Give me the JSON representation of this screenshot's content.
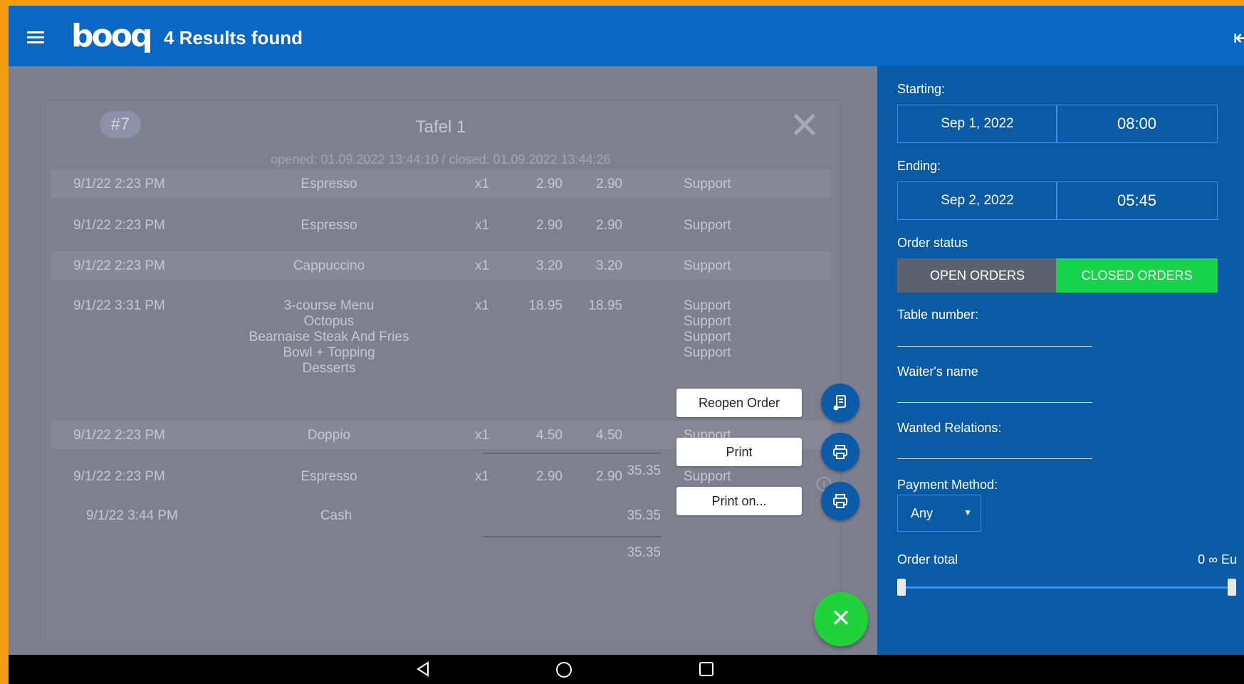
{
  "header": {
    "logo": "booq",
    "title": "4 Results found",
    "back_icon": "logout-arrow-icon"
  },
  "order": {
    "number": "#7",
    "table": "Tafel 1",
    "times": "opened: 01.09.2022 13:44:10 / closed: 01.09.2022 13:44:26",
    "rows": [
      {
        "time": "9/1/22 2:23 PM",
        "items": [
          "Espresso"
        ],
        "qty": "x1",
        "price": "2.90",
        "total": "2.90",
        "users": [
          "Support"
        ]
      },
      {
        "time": "9/1/22 2:23 PM",
        "items": [
          "Espresso"
        ],
        "qty": "x1",
        "price": "2.90",
        "total": "2.90",
        "users": [
          "Support"
        ]
      },
      {
        "time": "9/1/22 2:23 PM",
        "items": [
          "Cappuccino"
        ],
        "qty": "x1",
        "price": "3.20",
        "total": "3.20",
        "users": [
          "Support"
        ]
      },
      {
        "time": "9/1/22 3:31 PM",
        "items": [
          "3-course Menu",
          "Octopus",
          "Bearnaise Steak And Fries",
          "Bowl + Topping",
          "Desserts"
        ],
        "qty": "x1",
        "price": "18.95",
        "total": "18.95",
        "users": [
          "Support",
          "Support",
          "Support",
          "Support"
        ]
      },
      {
        "time": "9/1/22 2:23 PM",
        "items": [
          "Doppio"
        ],
        "qty": "x1",
        "price": "4.50",
        "total": "4.50",
        "users": [
          "Support"
        ]
      },
      {
        "time": "9/1/22 2:23 PM",
        "items": [
          "Espresso"
        ],
        "qty": "x1",
        "price": "2.90",
        "total": "2.90",
        "users": [
          "Support"
        ]
      }
    ],
    "subtotal": "35.35",
    "payment": {
      "time": "9/1/22 3:44 PM",
      "method": "Cash",
      "amount": "35.35"
    },
    "grand_total": "35.35",
    "info_icon": "ⓘ"
  },
  "actions": {
    "reopen": "Reopen Order",
    "print": "Print",
    "print_on": "Print on...",
    "close_fab": "✕"
  },
  "filters": {
    "starting_label": "Starting:",
    "starting_date": "Sep 1, 2022",
    "starting_time": "08:00",
    "ending_label": "Ending:",
    "ending_date": "Sep 2, 2022",
    "ending_time": "05:45",
    "order_status_label": "Order status",
    "open_orders": "OPEN ORDERS",
    "closed_orders": "CLOSED ORDERS",
    "table_number_label": "Table number:",
    "waiter_label": "Waiter's name",
    "relations_label": "Wanted Relations:",
    "payment_label": "Payment Method:",
    "payment_value": "Any",
    "order_total_label": "Order total",
    "order_total_range": "0 ∞ Eu"
  },
  "colors": {
    "header_bg": "#0a68c4",
    "filter_bg": "#0b5aa5",
    "closed_orders_active": "#17d24b",
    "fab_green": "#21d33b"
  }
}
